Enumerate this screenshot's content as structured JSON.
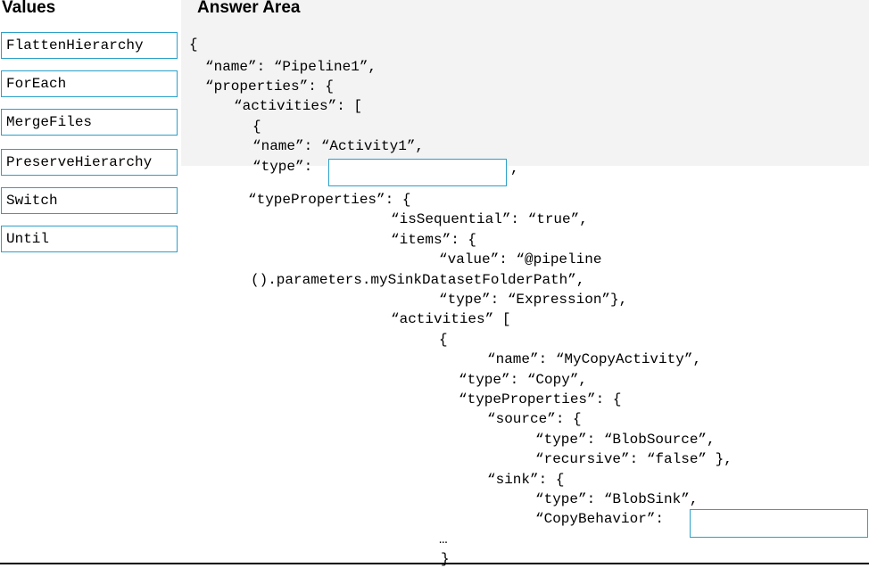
{
  "values_panel": {
    "heading": "Values",
    "items": [
      {
        "label": "FlattenHierarchy"
      },
      {
        "label": "ForEach"
      },
      {
        "label": "MergeFiles"
      },
      {
        "label": "PreserveHierarchy"
      },
      {
        "label": "Switch"
      },
      {
        "label": "Until"
      }
    ]
  },
  "answer_area": {
    "heading": "Answer Area",
    "code": [
      "{",
      "“name”: “Pipeline1”,",
      "“properties”: {",
      "“activities”: [",
      "{",
      "“name”: “Activity1”,",
      "“type”:",
      ",",
      "“typeProperties”: {",
      "“isSequential”: “true”,",
      "“items”: {",
      "“value”: “@pipeline",
      "().parameters.mySinkDatasetFolderPath”,",
      "“type”: “Expression”},",
      "“activities” [",
      "{",
      "“name”: “MyCopyActivity”,",
      "“type”: “Copy”,",
      "“typeProperties”: {",
      "“source”: {",
      "“type”: “BlobSource”,",
      "“recursive”: “false” },",
      "“sink”: {",
      "“type”: “BlobSink”,",
      "“CopyBehavior”:",
      "…",
      "}"
    ]
  },
  "colors": {
    "box_border": "#2aa0c9",
    "panel_background": "#f3f3f3"
  }
}
